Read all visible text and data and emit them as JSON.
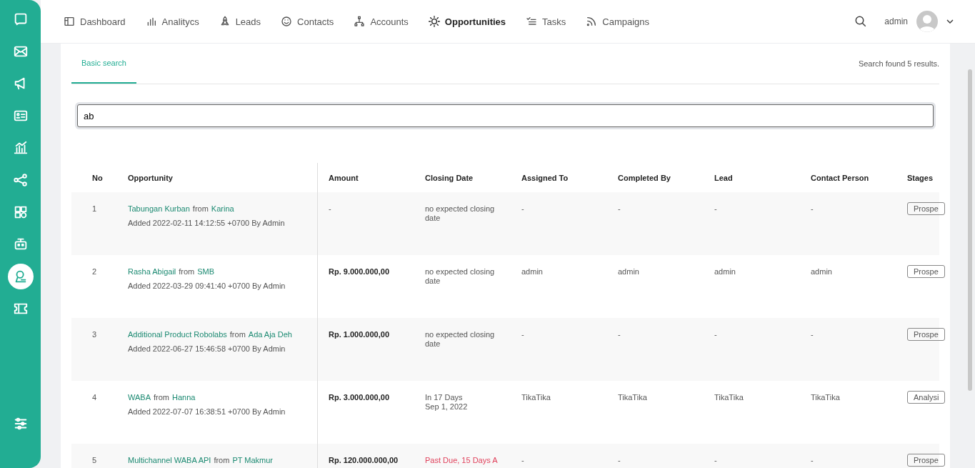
{
  "sidebar": {
    "items": [
      {
        "selected": false
      },
      {
        "selected": false
      },
      {
        "selected": false
      },
      {
        "selected": false
      },
      {
        "selected": false
      },
      {
        "selected": false
      },
      {
        "selected": false
      },
      {
        "selected": false
      },
      {
        "selected": true
      },
      {
        "selected": false
      }
    ]
  },
  "nav": {
    "items": [
      {
        "label": "Dashboard",
        "selected": false
      },
      {
        "label": "Analitycs",
        "selected": false
      },
      {
        "label": "Leads",
        "selected": false
      },
      {
        "label": "Contacts",
        "selected": false
      },
      {
        "label": "Accounts",
        "selected": false
      },
      {
        "label": "Opportunities",
        "selected": true
      },
      {
        "label": "Tasks",
        "selected": false
      },
      {
        "label": "Campaigns",
        "selected": false
      }
    ],
    "user": "admin"
  },
  "tabs": [
    {
      "label": "Basic search",
      "selected": true
    }
  ],
  "result_count": "Search found 5 results.",
  "search": {
    "value": "ab"
  },
  "table": {
    "columns": [
      "No",
      "Opportunity",
      "Amount",
      "Closing Date",
      "Assigned To",
      "Completed By",
      "Lead",
      "Contact Person",
      "Stages"
    ],
    "rows": [
      {
        "no": "1",
        "title": [
          {
            "text": "Tabungan Kurban",
            "kind": "link"
          },
          {
            "text": "from",
            "kind": "plain"
          },
          {
            "text": "Karina",
            "kind": "link"
          }
        ],
        "added": "Added 2022-02-11 14:12:55 +0700 By Admin",
        "amount": "-",
        "closing": {
          "kind": "none",
          "lines": [
            "no expected closing date"
          ]
        },
        "assigned_to": "-",
        "completed_by": "-",
        "lead": "-",
        "contact_person": "-",
        "stage": "Prospe"
      },
      {
        "no": "2",
        "title": [
          {
            "text": "Rasha Abigail",
            "kind": "link"
          },
          {
            "text": "from",
            "kind": "plain"
          },
          {
            "text": "SMB",
            "kind": "link"
          }
        ],
        "added": "Added 2022-03-29 09:41:40 +0700 By Admin",
        "amount": "Rp. 9.000.000,00",
        "closing": {
          "kind": "none",
          "lines": [
            "no expected closing date"
          ]
        },
        "assigned_to": "admin",
        "completed_by": "admin",
        "lead": "admin",
        "contact_person": "admin",
        "stage": "Prospe"
      },
      {
        "no": "3",
        "title": [
          {
            "text": "Additional Product Robolabs",
            "kind": "link"
          },
          {
            "text": "from",
            "kind": "plain"
          },
          {
            "text": "Ada Aja Deh",
            "kind": "link"
          }
        ],
        "added": "Added 2022-06-27 15:46:58 +0700 By Admin",
        "amount": "Rp. 1.000.000,00",
        "closing": {
          "kind": "none",
          "lines": [
            "no expected closing date"
          ]
        },
        "assigned_to": "-",
        "completed_by": "-",
        "lead": "-",
        "contact_person": "-",
        "stage": "Prospe"
      },
      {
        "no": "4",
        "title": [
          {
            "text": "WABA",
            "kind": "link"
          },
          {
            "text": "from",
            "kind": "plain"
          },
          {
            "text": "Hanna",
            "kind": "link"
          }
        ],
        "added": "Added 2022-07-07 16:38:51 +0700 By Admin",
        "amount": "Rp. 3.000.000,00",
        "closing": {
          "kind": "upcoming",
          "lines": [
            "In 17 Days",
            "Sep 1, 2022"
          ]
        },
        "assigned_to": "TikaTika",
        "completed_by": "TikaTika",
        "lead": "TikaTika",
        "contact_person": "TikaTika",
        "stage": "Analysi"
      },
      {
        "no": "5",
        "title": [
          {
            "text": "Multichannel WABA API",
            "kind": "link"
          },
          {
            "text": "from",
            "kind": "plain"
          },
          {
            "text": "PT Makmur",
            "kind": "link"
          }
        ],
        "amount": "Rp. 120.000.000,00",
        "closing": {
          "kind": "overdue",
          "lines": [
            "Past Due, 15 Days A"
          ]
        },
        "assigned_to": "-",
        "completed_by": "-",
        "lead": "-",
        "contact_person": "-",
        "stage": "Prospe"
      }
    ]
  }
}
